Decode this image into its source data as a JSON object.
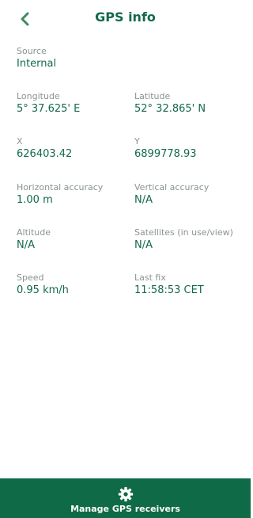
{
  "header": {
    "title": "GPS info",
    "back_icon": "chevron-left-icon"
  },
  "fields": {
    "source": {
      "label": "Source",
      "value": "Internal"
    },
    "longitude": {
      "label": "Longitude",
      "value": "5° 37.625' E"
    },
    "latitude": {
      "label": "Latitude",
      "value": "52° 32.865' N"
    },
    "x": {
      "label": "X",
      "value": "626403.42"
    },
    "y": {
      "label": "Y",
      "value": "6899778.93"
    },
    "horizontal_accuracy": {
      "label": "Horizontal accuracy",
      "value": "1.00 m"
    },
    "vertical_accuracy": {
      "label": "Vertical accuracy",
      "value": "N/A"
    },
    "altitude": {
      "label": "Altitude",
      "value": "N/A"
    },
    "satellites": {
      "label": "Satellites (in use/view)",
      "value": "N/A"
    },
    "speed": {
      "label": "Speed",
      "value": "0.95 km/h"
    },
    "last_fix": {
      "label": "Last fix",
      "value": "11:58:53 CET"
    }
  },
  "footer": {
    "label": "Manage GPS receivers",
    "icon": "gear-icon"
  },
  "colors": {
    "brand": "#0f6a47",
    "value_text": "#146a4a",
    "label_text": "#8a9490",
    "background": "#ffffff"
  }
}
